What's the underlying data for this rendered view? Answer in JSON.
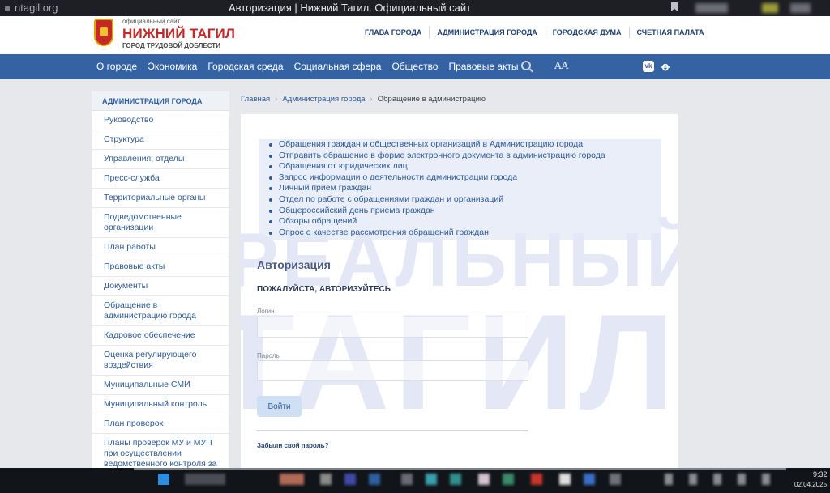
{
  "browser": {
    "url": "ntagil.org",
    "tab_title": "Авторизация | Нижний Тагил. Официальный сайт"
  },
  "header": {
    "logo_small": "официальный сайт",
    "logo_main": "НИЖНИЙ ТАГИЛ",
    "logo_sub": "ГОРОД ТРУДОВОЙ ДОБЛЕСТИ",
    "top_links": [
      "ГЛАВА ГОРОДА",
      "АДМИНИСТРАЦИЯ ГОРОДА",
      "ГОРОДСКАЯ ДУМА",
      "СЧЕТНАЯ ПАЛАТА"
    ]
  },
  "nav": {
    "items": [
      "О городе",
      "Экономика",
      "Городская среда",
      "Социальная сфера",
      "Общество",
      "Правовые акты"
    ],
    "font_toggle": "AA",
    "vk": "vk",
    "ok": "ok"
  },
  "sidebar": {
    "heading": "АДМИНИСТРАЦИЯ ГОРОДА",
    "items": [
      "Руководство",
      "Структура",
      "Управления, отделы",
      "Пресс-служба",
      "Территориальные органы",
      "Подведомственные организации",
      "План работы",
      "Правовые акты",
      "Документы",
      "Обращение в администрацию города",
      "Кадровое обеспечение",
      "Оценка регулирующего воздействия",
      "Муниципальные СМИ",
      "Муниципальный контроль",
      "План проверок",
      "Планы проверок МУ и МУП при осуществлении ведомственного контроля за соблюдением трудового"
    ]
  },
  "breadcrumb": {
    "home": "Главная",
    "section": "Администрация города",
    "current": "Обращение в администрацию",
    "sep": "›"
  },
  "content": {
    "links": [
      "Обращения граждан и общественных организаций в Администрацию города",
      "Отправить обращение в форме электронного документа в администрацию города",
      "Обращения от юридических лиц",
      "Запрос информации о деятельности администрации города",
      "Личный прием граждан",
      "Отдел по работе с обращениями граждан и организаций",
      "Общероссийский день приема граждан",
      "Обзоры обращений",
      "Опрос о качестве рассмотрения обращений граждан"
    ],
    "watermark_line1": "РЕАЛЬНЫЙ",
    "watermark_line2": "ТАГИЛ",
    "auth_title": "Авторизация",
    "auth_subtitle": "ПОЖАЛУЙСТА, АВТОРИЗУЙТЕСЬ",
    "login_label": "Логин",
    "password_label": "Пароль",
    "login_button": "Войти",
    "forgot_link": "Забыли свой пароль?"
  },
  "taskbar": {
    "time": "9:32",
    "date": "02.04.2025"
  },
  "colors": {
    "brand_red": "#c62828",
    "nav_blue": "#3562a3",
    "link_blue": "#2d5a96"
  }
}
